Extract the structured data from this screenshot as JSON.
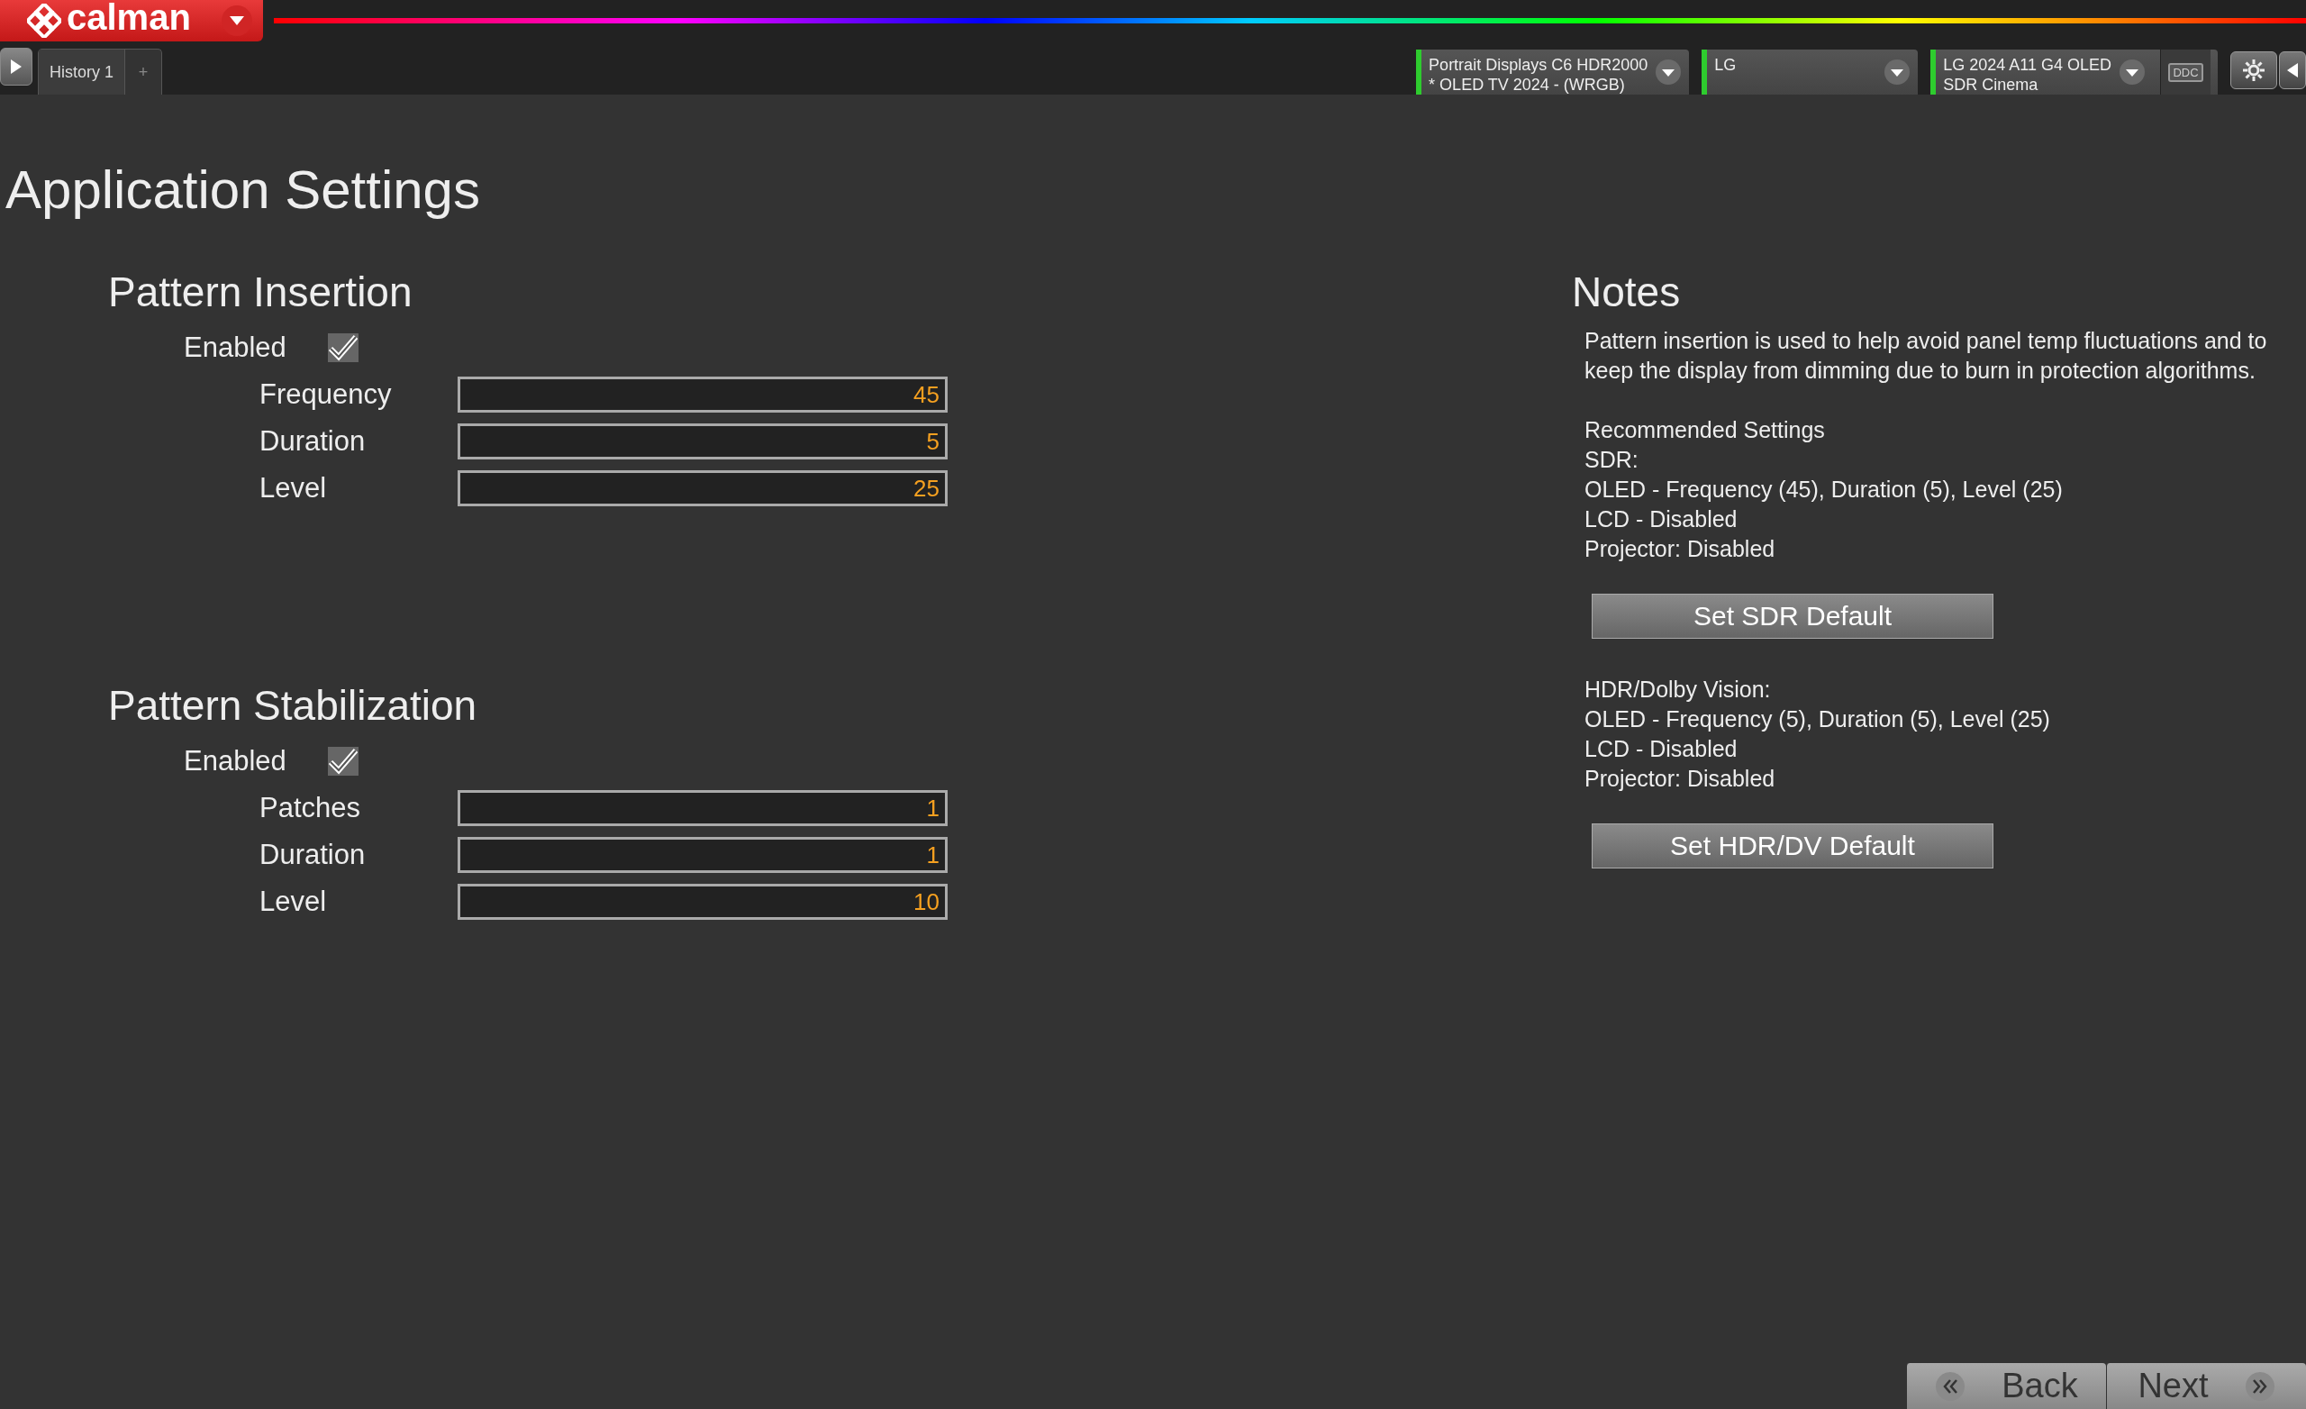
{
  "header": {
    "app_name": "calman"
  },
  "tabs": [
    {
      "label": "History 1",
      "selected": true
    }
  ],
  "new_tab": "+",
  "device_selectors": [
    {
      "line1": "Portrait Displays C6 HDR2000",
      "line2": "* OLED TV 2024 - (WRGB)",
      "connected": true
    },
    {
      "line1": "LG",
      "connected": true
    },
    {
      "line1": "LG 2024 A11 G4 OLED",
      "line2": "SDR Cinema",
      "connected": true
    }
  ],
  "ddc_label": "DDC",
  "page_title": "Application Settings",
  "sections": [
    {
      "title": "Pattern Insertion",
      "enabled_label": "Enabled",
      "enabled": true,
      "fields": [
        {
          "label": "Frequency",
          "value": "45"
        },
        {
          "label": "Duration",
          "value": "5"
        },
        {
          "label": "Level",
          "value": "25"
        }
      ]
    },
    {
      "title": "Pattern Stabilization",
      "enabled_label": "Enabled",
      "enabled": true,
      "fields": [
        {
          "label": "Patches",
          "value": "1"
        },
        {
          "label": "Duration",
          "value": "1"
        },
        {
          "label": "Level",
          "value": "10"
        }
      ]
    }
  ],
  "notes": {
    "title": "Notes",
    "blocks": [
      {
        "kind": "paragraph",
        "text": "Pattern insertion is used to help avoid panel temp fluctuations and to keep the display from dimming due to burn in protection algorithms."
      },
      {
        "kind": "lines",
        "lines": [
          "Recommended Settings",
          "SDR:",
          "OLED - Frequency (45), Duration (5), Level (25)",
          "LCD - Disabled",
          "Projector: Disabled"
        ]
      },
      {
        "kind": "button",
        "label": "Set SDR Default"
      },
      {
        "kind": "lines",
        "lines": [
          "HDR/Dolby Vision:",
          "OLED - Frequency (5), Duration (5), Level (25)",
          "LCD - Disabled",
          "Projector: Disabled"
        ]
      },
      {
        "kind": "button",
        "label": "Set HDR/DV Default"
      }
    ]
  },
  "nav_buttons": [
    {
      "kind": "back",
      "label": "Back"
    },
    {
      "kind": "next",
      "label": "Next"
    }
  ]
}
